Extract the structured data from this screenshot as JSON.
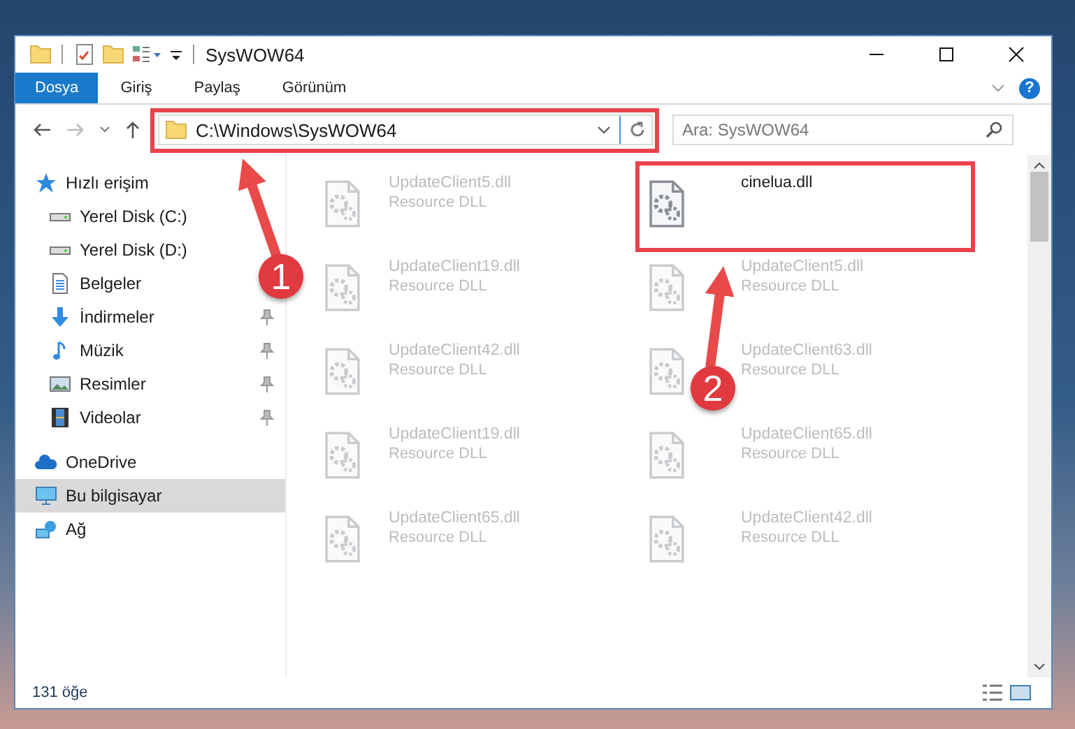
{
  "window": {
    "title": "SysWOW64"
  },
  "ribbon": {
    "tabs": [
      {
        "label": "Dosya",
        "selected": true
      },
      {
        "label": "Giriş",
        "selected": false
      },
      {
        "label": "Paylaş",
        "selected": false
      },
      {
        "label": "Görünüm",
        "selected": false
      }
    ],
    "help": "?"
  },
  "address_bar": {
    "path": "C:\\Windows\\SysWOW64"
  },
  "search": {
    "placeholder": "Ara: SysWOW64"
  },
  "sidebar": {
    "items": [
      {
        "label": "Hızlı erişim",
        "kind": "star",
        "selected": false,
        "children": [
          {
            "label": "Yerel Disk (C:)",
            "kind": "drive",
            "selected": false,
            "pinned": false
          },
          {
            "label": "Yerel Disk (D:)",
            "kind": "drive",
            "selected": false,
            "pinned": false
          },
          {
            "label": "Belgeler",
            "kind": "documents",
            "selected": false,
            "pinned": false
          },
          {
            "label": "İndirmeler",
            "kind": "downloads",
            "selected": false,
            "pinned": true
          },
          {
            "label": "Müzik",
            "kind": "music",
            "selected": false,
            "pinned": true
          },
          {
            "label": "Resimler",
            "kind": "pictures",
            "selected": false,
            "pinned": true
          },
          {
            "label": "Videolar",
            "kind": "videos",
            "selected": false,
            "pinned": true
          }
        ]
      },
      {
        "label": "OneDrive",
        "kind": "cloud",
        "selected": false
      },
      {
        "label": "Bu bilgisayar",
        "kind": "computer",
        "selected": true
      },
      {
        "label": "Ağ",
        "kind": "network",
        "selected": false
      }
    ]
  },
  "files": [
    {
      "name": "UpdateClient5.dll",
      "type": "Resource DLL",
      "blurred": true
    },
    {
      "name": "cinelua.dll",
      "blurred": false
    },
    {
      "name": "UpdateClient19.dll",
      "type": "Resource DLL",
      "blurred": true
    },
    {
      "name": "UpdateClient5.dll",
      "type": "Resource DLL",
      "blurred": true
    },
    {
      "name": "UpdateClient42.dll",
      "type": "Resource DLL",
      "blurred": true
    },
    {
      "name": "UpdateClient63.dll",
      "type": "Resource DLL",
      "blurred": true
    },
    {
      "name": "UpdateClient19.dll",
      "type": "Resource DLL",
      "blurred": true
    },
    {
      "name": "UpdateClient65.dll",
      "type": "Resource DLL",
      "blurred": true
    },
    {
      "name": "UpdateClient65.dll",
      "type": "Resource DLL",
      "blurred": true
    },
    {
      "name": "UpdateClient42.dll",
      "type": "Resource DLL",
      "blurred": true
    }
  ],
  "annotations": [
    {
      "number": "1"
    },
    {
      "number": "2"
    }
  ],
  "status_bar": {
    "count": "131 öğe"
  }
}
